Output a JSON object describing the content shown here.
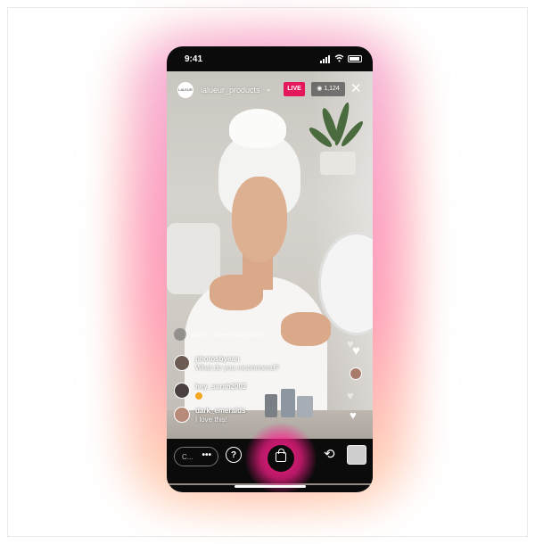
{
  "status": {
    "time": "9:41"
  },
  "header": {
    "avatar_text": "LALEUR",
    "username": "lalueur_products",
    "username_chevron": "⌄",
    "live_label": "LIVE",
    "viewers": "1,124",
    "close": "✕"
  },
  "comments": {
    "joined": "travis_shreds18 joined",
    "items": [
      {
        "name": "photosbyean",
        "text": "What do you recommend?"
      },
      {
        "name": "hey_sarah2002",
        "text": ""
      },
      {
        "name": "dark_emeralds",
        "text": "I love this!"
      }
    ]
  },
  "bottom": {
    "comment_placeholder": "C...",
    "more": "•••",
    "question": "?",
    "flip": "⟲"
  },
  "colors": {
    "live": "#e4175c",
    "glow": "#ff1e8c"
  },
  "icons": [
    "question-icon",
    "shopping-bag-icon",
    "camera-flip-icon",
    "heart-icon",
    "close-icon",
    "eye-icon"
  ]
}
